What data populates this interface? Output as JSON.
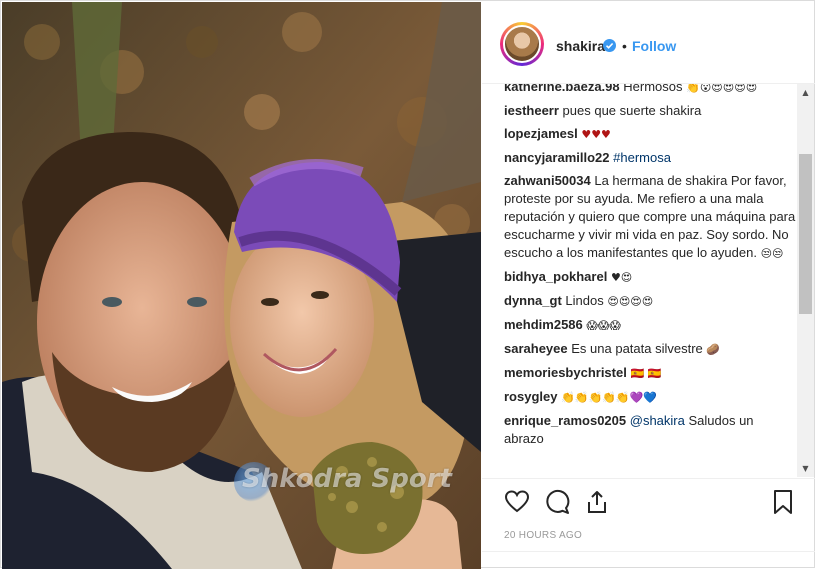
{
  "header": {
    "username": "shakira",
    "separator": "•",
    "follow_label": "Follow",
    "verified_color": "#3897f0"
  },
  "comments": [
    {
      "user": "katherine.baeza.98",
      "text": "Hermosos",
      "emoji": "👏😮😍😍😍😍"
    },
    {
      "user": "iestheerr",
      "text": "pues que suerte shakira"
    },
    {
      "user": "lopezjamesl",
      "text": "",
      "emoji": "♥♥♥"
    },
    {
      "user": "nancyjaramillo22",
      "text": "#hermosa"
    },
    {
      "user": "zahwani50034",
      "text": "La hermana de shakira Por favor, proteste por su ayuda. Me refiero a una mala reputación y quiero que compre una máquina para escucharme y vivir mi vida en paz. Soy sordo. No escucho a los manifestantes que lo ayuden.",
      "emoji": "😒😒"
    },
    {
      "user": "bidhya_pokharel",
      "text": "",
      "emoji": "♥😍"
    },
    {
      "user": "dynna_gt",
      "text": "Lindos",
      "emoji": "😍😍😍😍"
    },
    {
      "user": "mehdim2586",
      "text": "",
      "emoji": "😱😱😱"
    },
    {
      "user": "saraheyee",
      "text": "Es una patata silvestre",
      "emoji": "🥔"
    },
    {
      "user": "memoriesbychristel",
      "text": "🇪🇸 🇪🇸"
    },
    {
      "user": "rosygley",
      "text": "",
      "emoji": "👏👏👏👏👏💜💙"
    },
    {
      "user": "enrique_ramos0205",
      "mention": "@shakira",
      "text": "Saludos un abrazo"
    }
  ],
  "timestamp": "20 HOURS AGO",
  "watermark": "Shkodra Sport",
  "icons": {
    "like": "heart-icon",
    "comment": "comment-icon",
    "share": "share-icon",
    "save": "bookmark-icon"
  },
  "colors": {
    "link": "#3897f0",
    "text": "#262626",
    "muted": "#999999",
    "hat": "#7b4bb8"
  }
}
